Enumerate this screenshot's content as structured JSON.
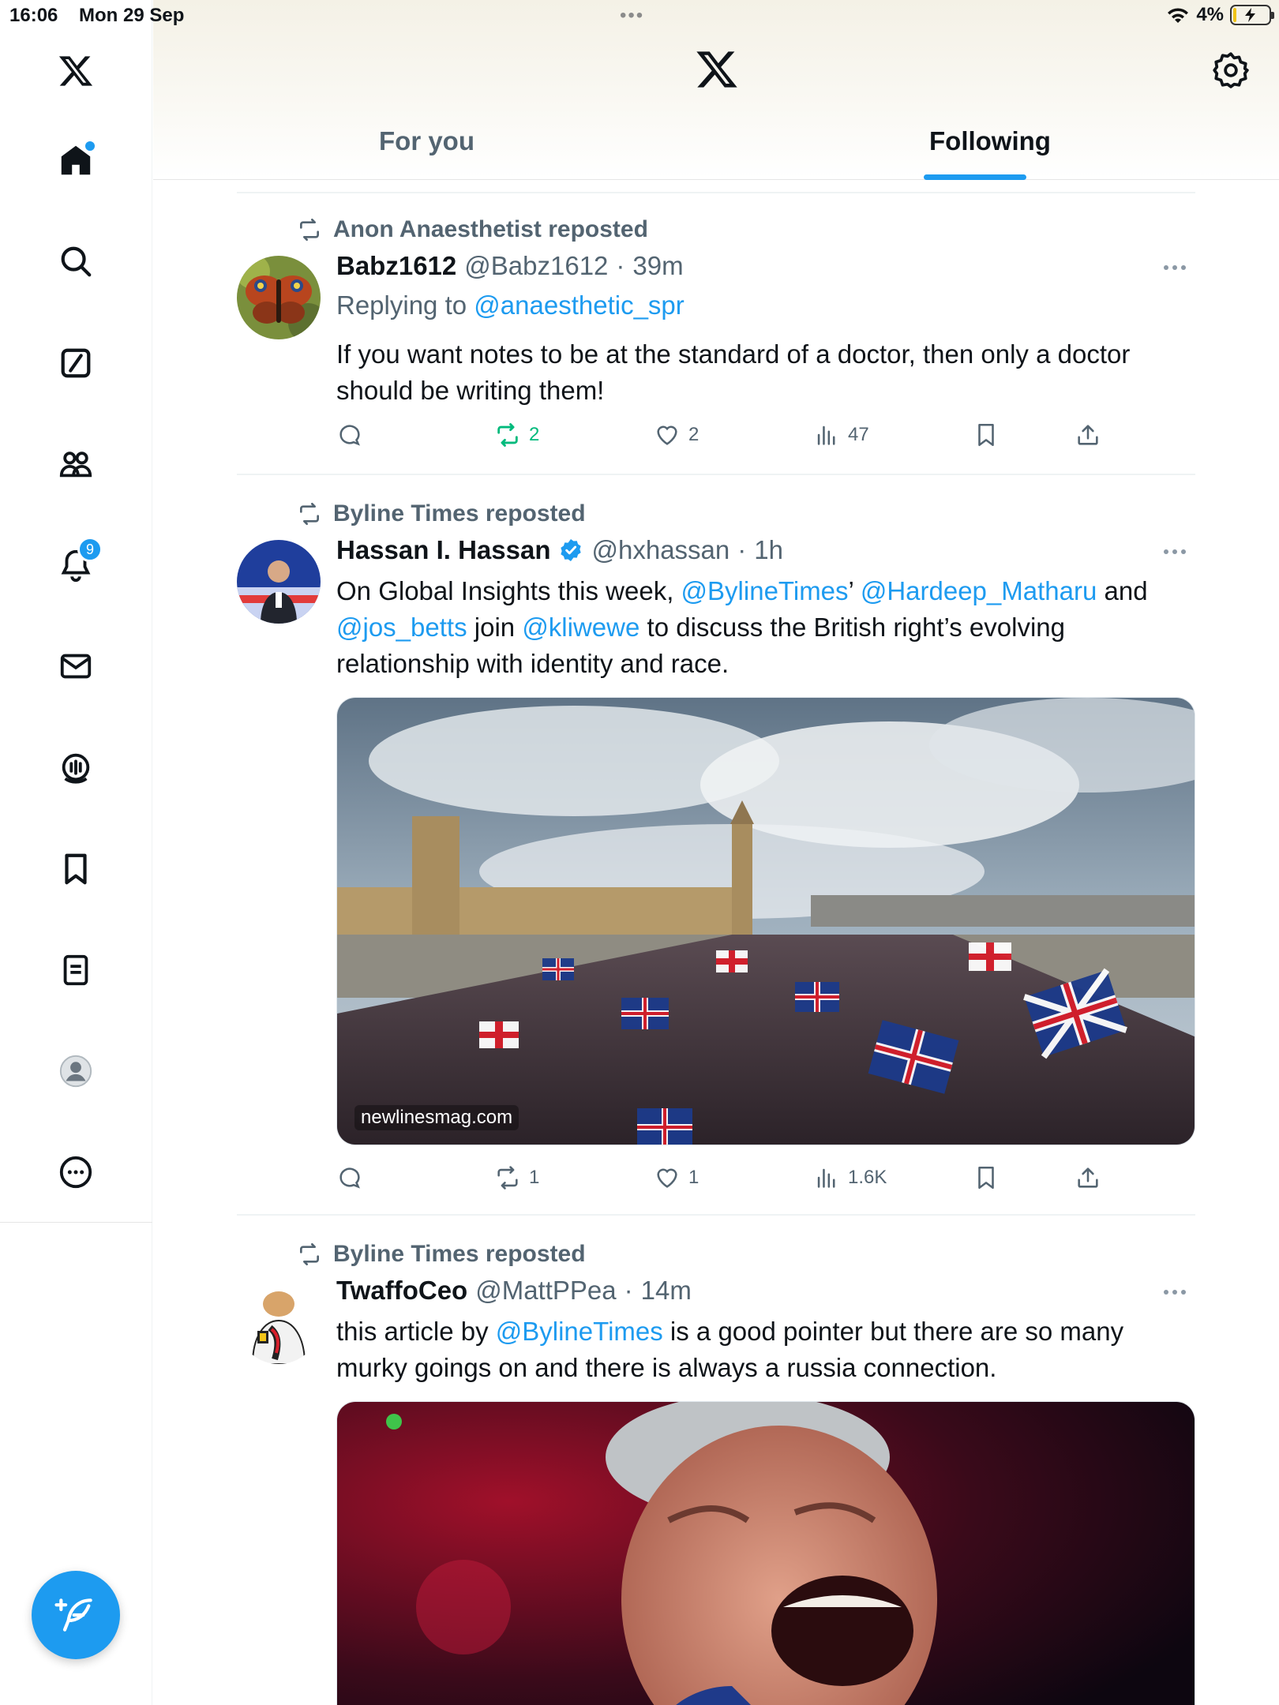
{
  "status_bar": {
    "time": "16:06",
    "date": "Mon 29 Sep",
    "dots": "•••",
    "battery": "4%"
  },
  "sidebar": {
    "notifications_badge": "9"
  },
  "header": {
    "tabs": [
      {
        "label": "For you",
        "selected": false
      },
      {
        "label": "Following",
        "selected": true
      }
    ]
  },
  "colors": {
    "accent": "#1d9bf0",
    "repost_green": "#00ba7c",
    "muted": "#536471"
  },
  "posts": [
    {
      "repost_by": "Anon Anaesthetist reposted",
      "name": "Babz1612",
      "handle": "@Babz1612",
      "dot": "·",
      "time": "39m",
      "replying_prefix": "Replying to",
      "replying_handle": "@anaesthetic_spr",
      "text": "If you want notes to be at the standard of a doctor, then only a doctor should be writing them!",
      "reposts": "2",
      "likes": "2",
      "views": "47"
    },
    {
      "repost_by": "Byline Times reposted",
      "name": "Hassan I. Hassan",
      "verified": true,
      "handle": "@hxhassan",
      "dot": "·",
      "time": "1h",
      "text_parts": {
        "a": "On Global Insights this week, ",
        "m1": "@BylineTimes",
        "b": "’ ",
        "m2": "@Hardeep_Matharu",
        "c": " and ",
        "m3": "@jos_betts",
        "d": " join ",
        "m4": "@kliwewe",
        "e": " to discuss the British right’s evolving relationship with identity and race."
      },
      "media_label": "newlinesmag.com",
      "reposts": "1",
      "likes": "1",
      "views": "1.6K"
    },
    {
      "repost_by": "Byline Times reposted",
      "name": "TwaffoCeo",
      "handle": "@MattPPea",
      "dot": "·",
      "time": "14m",
      "text_parts": {
        "a": "this article by ",
        "m1": "@BylineTimes",
        "b": " is a good pointer but there are so many murky goings on and there is always a russia connection."
      }
    }
  ]
}
